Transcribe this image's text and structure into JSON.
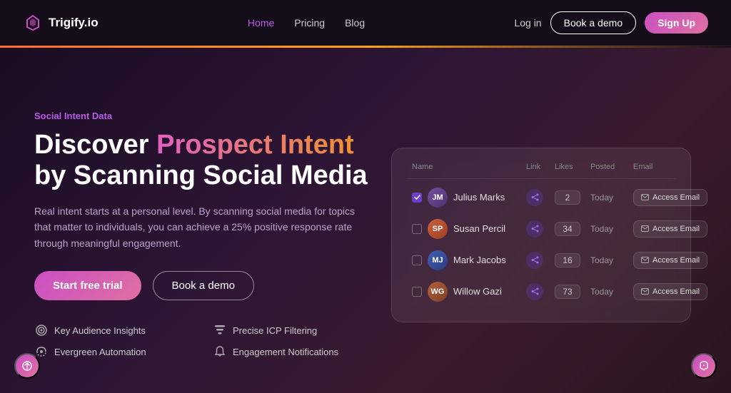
{
  "nav": {
    "logo_text": "Trigify.io",
    "links": [
      {
        "label": "Home",
        "active": true
      },
      {
        "label": "Pricing",
        "active": false
      },
      {
        "label": "Blog",
        "active": false
      }
    ],
    "login_label": "Log in",
    "demo_label": "Book a demo",
    "signup_label": "Sign Up"
  },
  "hero": {
    "tag": "Social Intent Data",
    "title_prefix": "Discover ",
    "title_gradient": "Prospect Intent",
    "title_suffix": " by Scanning Social Media",
    "description": "Real intent starts at a personal level. By scanning social media for topics that matter to individuals, you can achieve a 25% positive response rate through meaningful engagement.",
    "cta_trial": "Start free trial",
    "cta_demo": "Book a demo"
  },
  "features": [
    {
      "icon": "target-icon",
      "label": "Key Audience Insights"
    },
    {
      "icon": "filter-icon",
      "label": "Precise ICP Filtering"
    },
    {
      "icon": "automation-icon",
      "label": "Evergreen Automation"
    },
    {
      "icon": "bell-icon",
      "label": "Engagement Notifications"
    }
  ],
  "table": {
    "headers": [
      "Name",
      "Link",
      "Likes",
      "Posted",
      "Email"
    ],
    "rows": [
      {
        "name": "Julius Marks",
        "initials": "JM",
        "checked": true,
        "likes": "2",
        "posted": "Today",
        "email_label": "Access Email"
      },
      {
        "name": "Susan Percil",
        "initials": "SP",
        "checked": false,
        "likes": "34",
        "posted": "Today",
        "email_label": "Access Email"
      },
      {
        "name": "Mark Jacobs",
        "initials": "MJ",
        "checked": false,
        "likes": "16",
        "posted": "Today",
        "email_label": "Access Email"
      },
      {
        "name": "Willow Gazi",
        "initials": "WG",
        "checked": false,
        "likes": "73",
        "posted": "Today",
        "email_label": "Access Email"
      }
    ]
  }
}
